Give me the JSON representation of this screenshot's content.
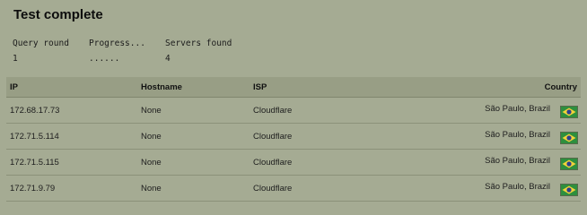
{
  "title": "Test complete",
  "stats": {
    "query_round_label": "Query round",
    "query_round_value": "1",
    "progress_label": "Progress...",
    "progress_value": "......",
    "servers_label": "Servers found",
    "servers_value": "4"
  },
  "table": {
    "headers": {
      "ip": "IP",
      "hostname": "Hostname",
      "isp": "ISP",
      "country": "Country"
    },
    "rows": [
      {
        "ip": "172.68.17.73",
        "hostname": "None",
        "isp": "Cloudflare",
        "country": "São Paulo, Brazil",
        "flag": "brazil-flag-icon"
      },
      {
        "ip": "172.71.5.114",
        "hostname": "None",
        "isp": "Cloudflare",
        "country": "São Paulo, Brazil",
        "flag": "brazil-flag-icon"
      },
      {
        "ip": "172.71.5.115",
        "hostname": "None",
        "isp": "Cloudflare",
        "country": "São Paulo, Brazil",
        "flag": "brazil-flag-icon"
      },
      {
        "ip": "172.71.9.79",
        "hostname": "None",
        "isp": "Cloudflare",
        "country": "São Paulo, Brazil",
        "flag": "brazil-flag-icon"
      }
    ]
  },
  "colors": {
    "background": "#a5ab93",
    "flag_green": "#2e8f3e",
    "flag_yellow": "#f2d23a",
    "flag_blue": "#2a3f8f"
  }
}
